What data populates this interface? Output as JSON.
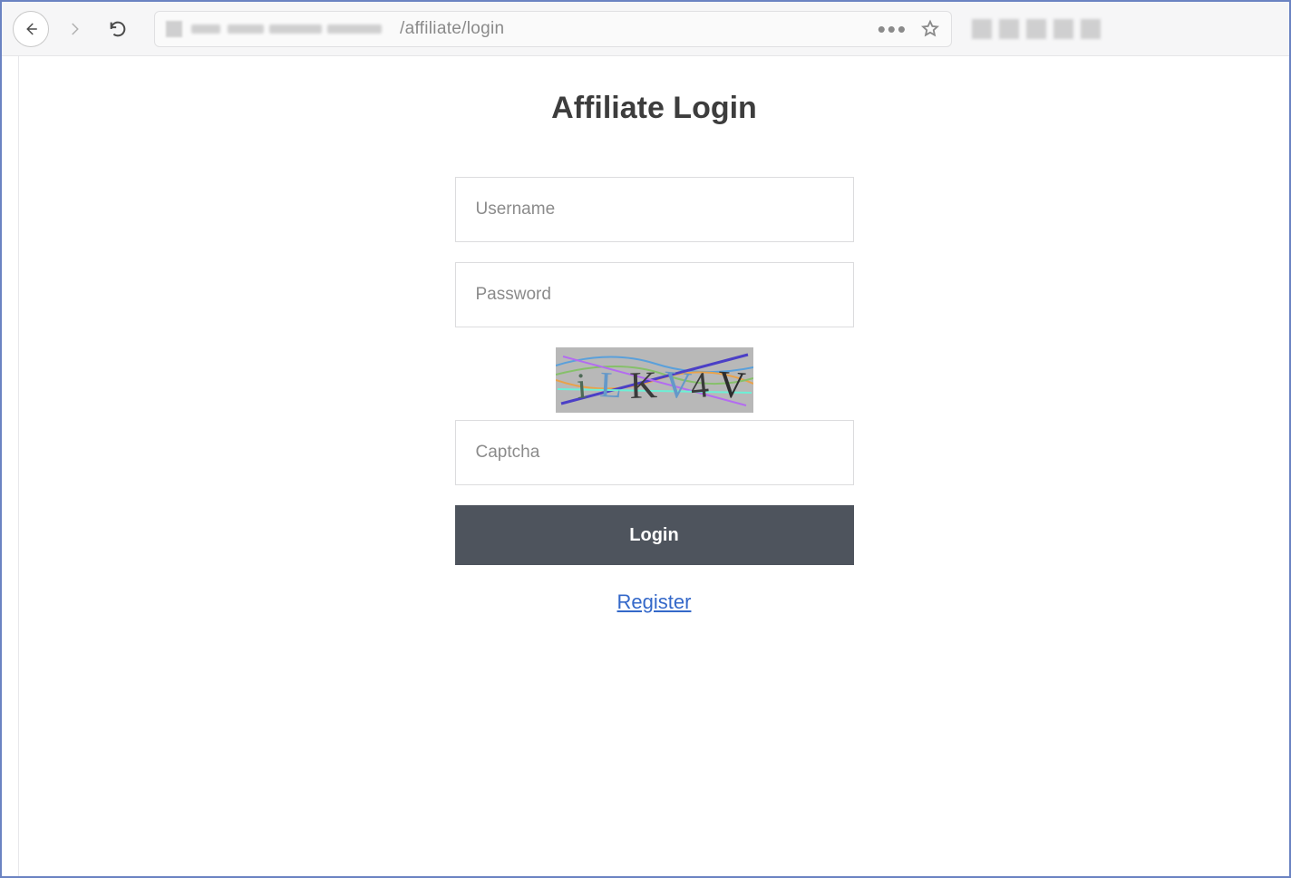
{
  "browser": {
    "url_visible": "/affiliate/login"
  },
  "page": {
    "title": "Affiliate Login",
    "username_placeholder": "Username",
    "password_placeholder": "Password",
    "captcha_placeholder": "Captcha",
    "captcha_text_approx": "iLKV4V",
    "login_button": "Login",
    "register_link": "Register"
  }
}
